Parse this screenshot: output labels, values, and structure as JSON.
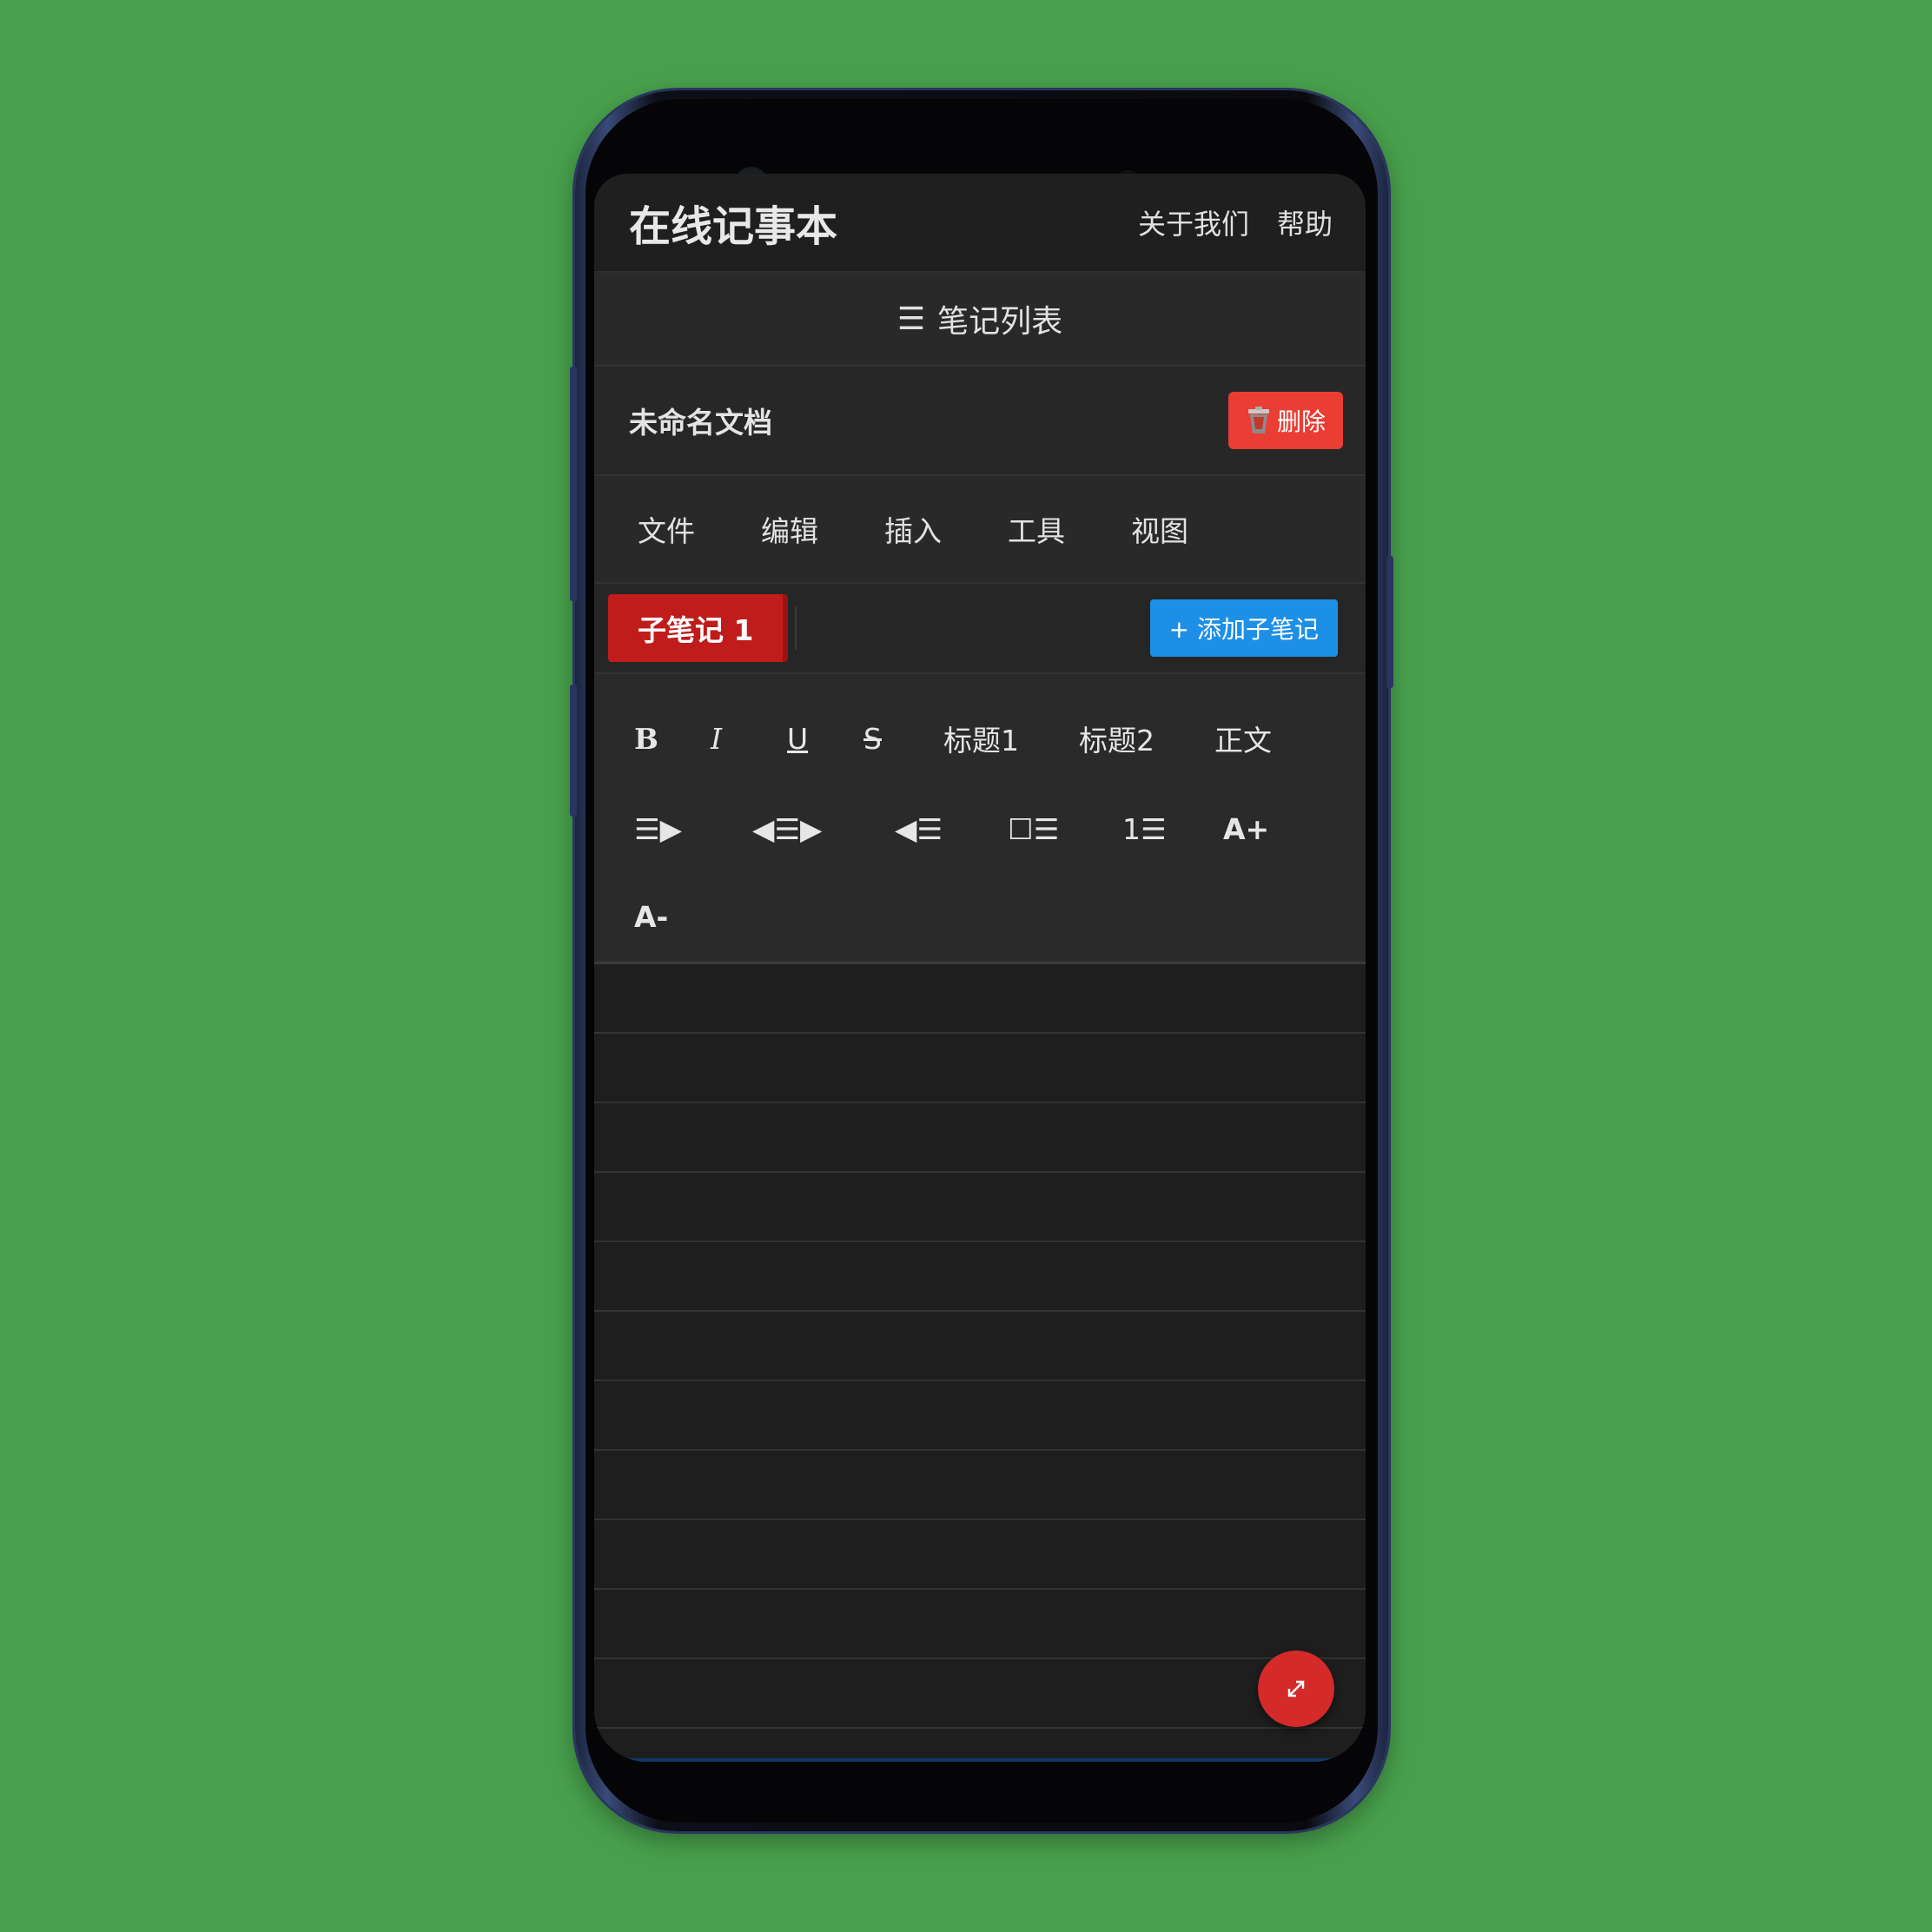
{
  "header": {
    "title": "在线记事本",
    "links": [
      "关于我们",
      "帮助"
    ]
  },
  "notes_list": {
    "icon": "hamburger-icon",
    "label": "笔记列表"
  },
  "document": {
    "title": "未命名文档",
    "delete_icon": "trash-icon",
    "delete_label": "删除"
  },
  "menu": [
    "文件",
    "编辑",
    "插入",
    "工具",
    "视图"
  ],
  "tabs": {
    "active": "子笔记 1",
    "add_label": "+ 添加子笔记"
  },
  "toolbar": {
    "bold": "B",
    "italic": "I",
    "underline": "U",
    "strike": "S",
    "h1": "标题1",
    "h2": "标题2",
    "body": "正文",
    "increase_font": "A+",
    "decrease_font": "A-",
    "ordered_list_num": "1"
  },
  "colors": {
    "background": "#48a04c",
    "delete": "#ea3d33",
    "tab_active": "#c01c1c",
    "add_button": "#1e8fe6",
    "fab": "#d42a2a"
  },
  "fab": {
    "icon": "expand-arrows-icon"
  }
}
